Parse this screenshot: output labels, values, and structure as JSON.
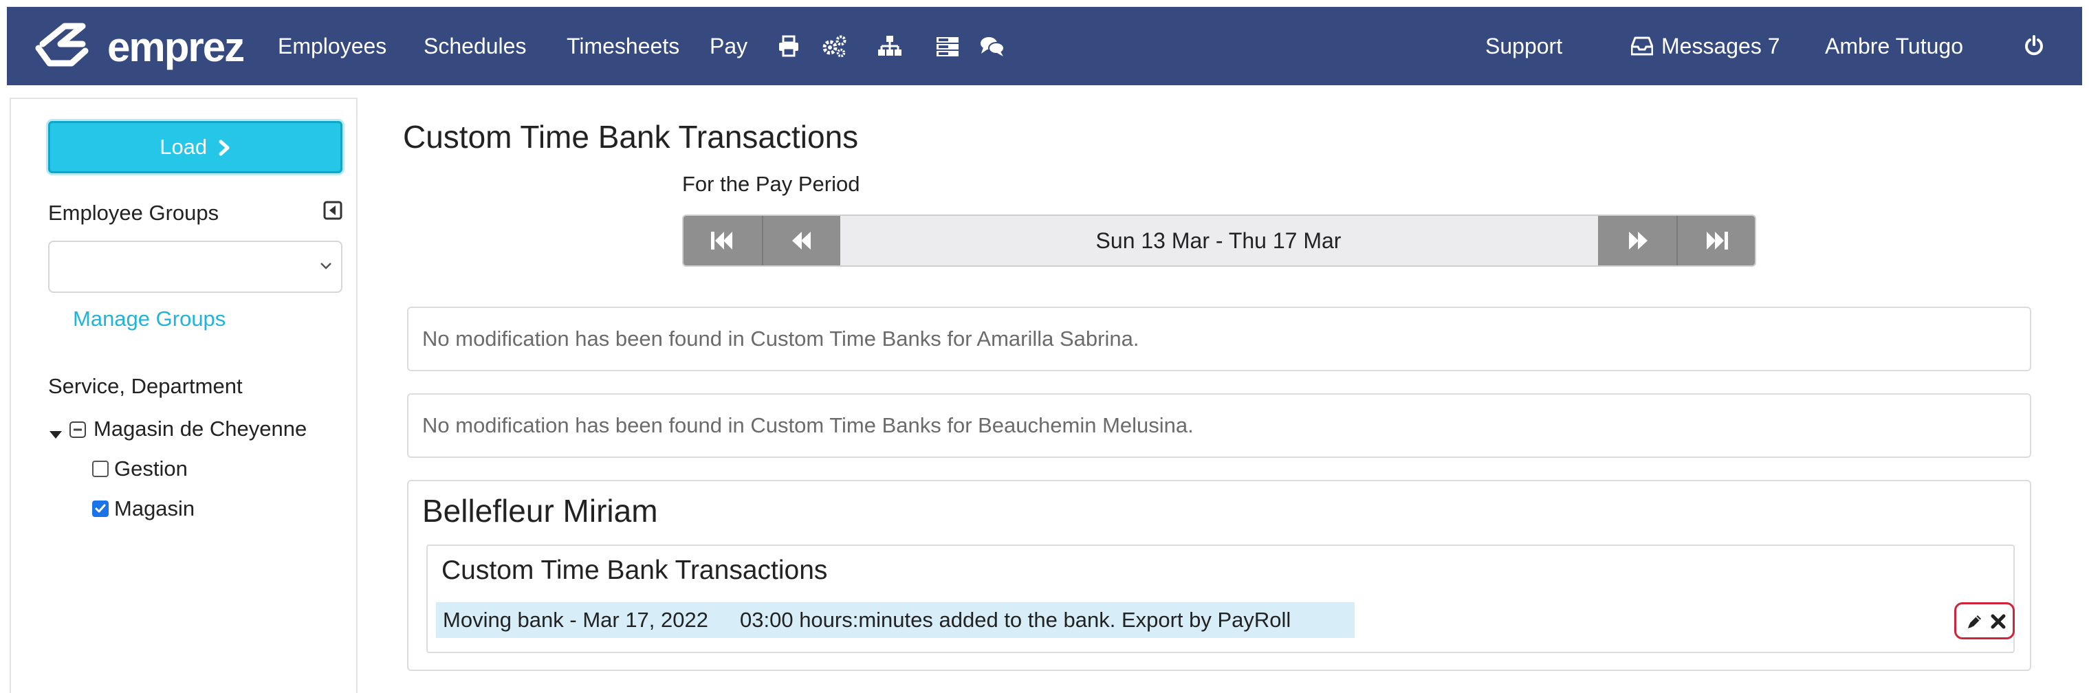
{
  "brand": {
    "name": "emprez"
  },
  "nav": {
    "items": [
      "Employees",
      "Schedules",
      "Timesheets",
      "Pay"
    ],
    "icons": [
      "printer-icon",
      "gears-icon",
      "org-chart-icon",
      "server-icon",
      "chat-icon"
    ],
    "support": "Support",
    "messages_label": "Messages",
    "messages_count": "7",
    "user": "Ambre Tutugo"
  },
  "sidebar": {
    "load_label": "Load",
    "employee_groups_label": "Employee Groups",
    "group_select_value": "",
    "manage_groups": "Manage Groups",
    "service_label": "Service, Department",
    "tree": {
      "root": "Magasin de Cheyenne",
      "children": [
        {
          "label": "Gestion",
          "checked": false
        },
        {
          "label": "Magasin",
          "checked": true
        }
      ]
    }
  },
  "main": {
    "title": "Custom Time Bank Transactions",
    "period_label": "For the Pay Period",
    "period": "Sun 13 Mar - Thu 17 Mar",
    "notices": [
      "No modification has been found in Custom Time Banks for Amarilla Sabrina.",
      "No modification has been found in Custom Time Banks for Beauchemin Melusina."
    ],
    "employee": {
      "name": "Bellefleur Miriam",
      "section_title": "Custom Time Bank Transactions",
      "transaction": {
        "desc": "Moving bank - Mar 17, 2022",
        "detail": "03:00 hours:minutes added to the bank. Export by PayRoll"
      }
    }
  },
  "colors": {
    "nav_bg": "#364a80",
    "load_button": "#26c6e8",
    "link": "#20b4d8",
    "pager_button": "#8f8f8f",
    "transaction_highlight": "#d7eef9",
    "action_border": "#d0243a"
  }
}
